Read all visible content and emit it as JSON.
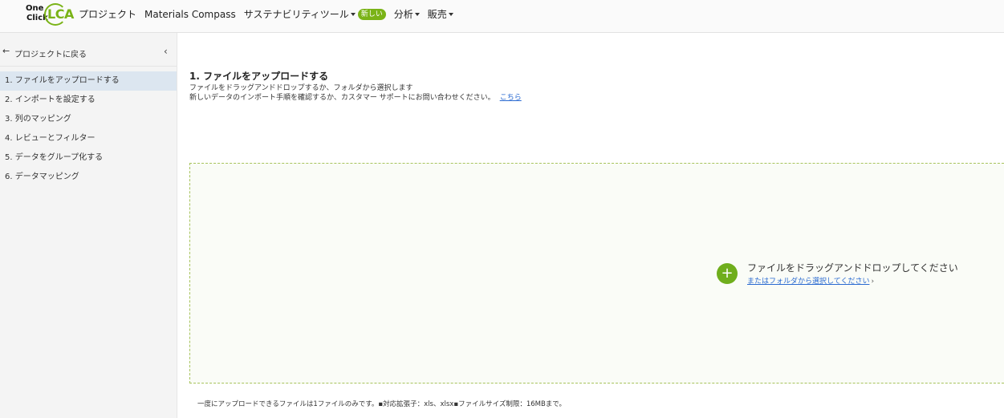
{
  "logo": {
    "line1": "One",
    "line2": "Click",
    "brand": "LCA"
  },
  "nav": {
    "items": [
      {
        "label": "プロジェクト",
        "caret": false
      },
      {
        "label": "Materials Compass",
        "caret": false
      },
      {
        "label": "サステナビリティツール",
        "caret": true,
        "badge": "新しい"
      },
      {
        "label": "分析",
        "caret": true
      },
      {
        "label": "販売",
        "caret": true
      }
    ]
  },
  "sidebar": {
    "back_label": "プロジェクトに戻る",
    "back_icon": "←",
    "collapse_icon": "‹",
    "steps": [
      {
        "label": "1. ファイルをアップロードする",
        "active": true
      },
      {
        "label": "2. インポートを設定する"
      },
      {
        "label": "3. 列のマッピング"
      },
      {
        "label": "4. レビューとフィルター"
      },
      {
        "label": "5. データをグループ化する"
      },
      {
        "label": "6. データマッピング"
      }
    ]
  },
  "main": {
    "title": "1. ファイルをアップロードする",
    "subtitle1": "ファイルをドラッグアンドドロップするか、フォルダから選択します",
    "subtitle2": "新しいデータのインポート手順を確認するか、カスタマー サポートにお問い合わせください。",
    "subtitle2_link": "こちら",
    "dropzone": {
      "icon": "+",
      "title": "ファイルをドラッグアンドドロップしてください",
      "link": "またはフォルダから選択してください",
      "chevron": "›"
    },
    "footer_note": "一度にアップロードできるファイルは1ファイルのみです。▪対応拡張子：xls、xlsx▪ファイルサイズ制限：16MBまで。"
  },
  "colors": {
    "accent": "#7ab317",
    "link": "#2a6ad1",
    "active_step_bg": "#dce6f0"
  }
}
